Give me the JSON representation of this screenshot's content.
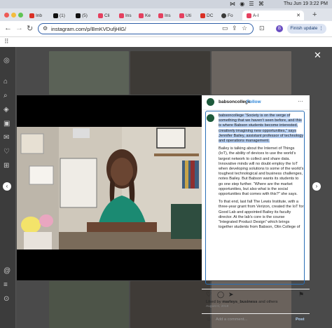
{
  "menubar": {
    "status_icons": "⋈ ◉ ☰ ⌘",
    "clock": "Thu Jun 19  3:22 PM"
  },
  "tabs": [
    {
      "label": "Inb",
      "color": "#d93025"
    },
    {
      "label": "(1)",
      "color": "#111111"
    },
    {
      "label": "(5)",
      "color": "#111111"
    },
    {
      "label": "Cli",
      "color": "#e4405f"
    },
    {
      "label": "Ins",
      "color": "#e4405f"
    },
    {
      "label": "Ke",
      "color": "#e4405f"
    },
    {
      "label": "Ins",
      "color": "#e4405f"
    },
    {
      "label": "Uti",
      "color": "#e4405f"
    },
    {
      "label": "DC",
      "color": "#d93025"
    },
    {
      "label": "Fo",
      "color": "#3a3a3a"
    },
    {
      "label": "A-I",
      "color": "#e4405f"
    }
  ],
  "toolbar": {
    "url": "instagram.com/p/BmKVDufjHlG/",
    "profile_initial": "B",
    "finish_update_label": "Finish update ⋮"
  },
  "post": {
    "username": "babsoncollege",
    "follow_label": "Follow",
    "caption_selected": "babsoncollege “Society is on the verge of something that we haven’t seen before, and this is where Babson students become interested, creatively imagining new opportunities,” says Jennifer Bailey, assistant professor of technology and operations management.",
    "caption_p2": "Bailey is talking about the Internet of Things (IoT), the ability of devices to use the world’s largest network to collect and share data. Innovative minds will no doubt employ the IoT when developing solutions to some of the world’s toughest technological and business challenges, notes Bailey. But Babson wants its students to go one step further. “Where are the market opportunities, but also what is the social opportunities that comes with this?” she says.",
    "caption_p3": "To that end, last fall The Lewis Institute, with a three-year grant from Verizon, created the IoT for Good Lab and appointed Bailey its faculty director. At the lab’s core is the course “Integrated Product Design” which brings together students from Babson, Olin College of",
    "liked_by_prefix": "Liked by ",
    "liked_by_user": "marleys_business",
    "liked_by_suffix": " and others",
    "date": "August 6, 2018",
    "comment_placeholder": "Add a comment...",
    "post_label": "Post"
  },
  "colors": {
    "brand_green": "#1d5a3c",
    "link_blue": "#2f86d8",
    "selection": "#b6cff2"
  }
}
